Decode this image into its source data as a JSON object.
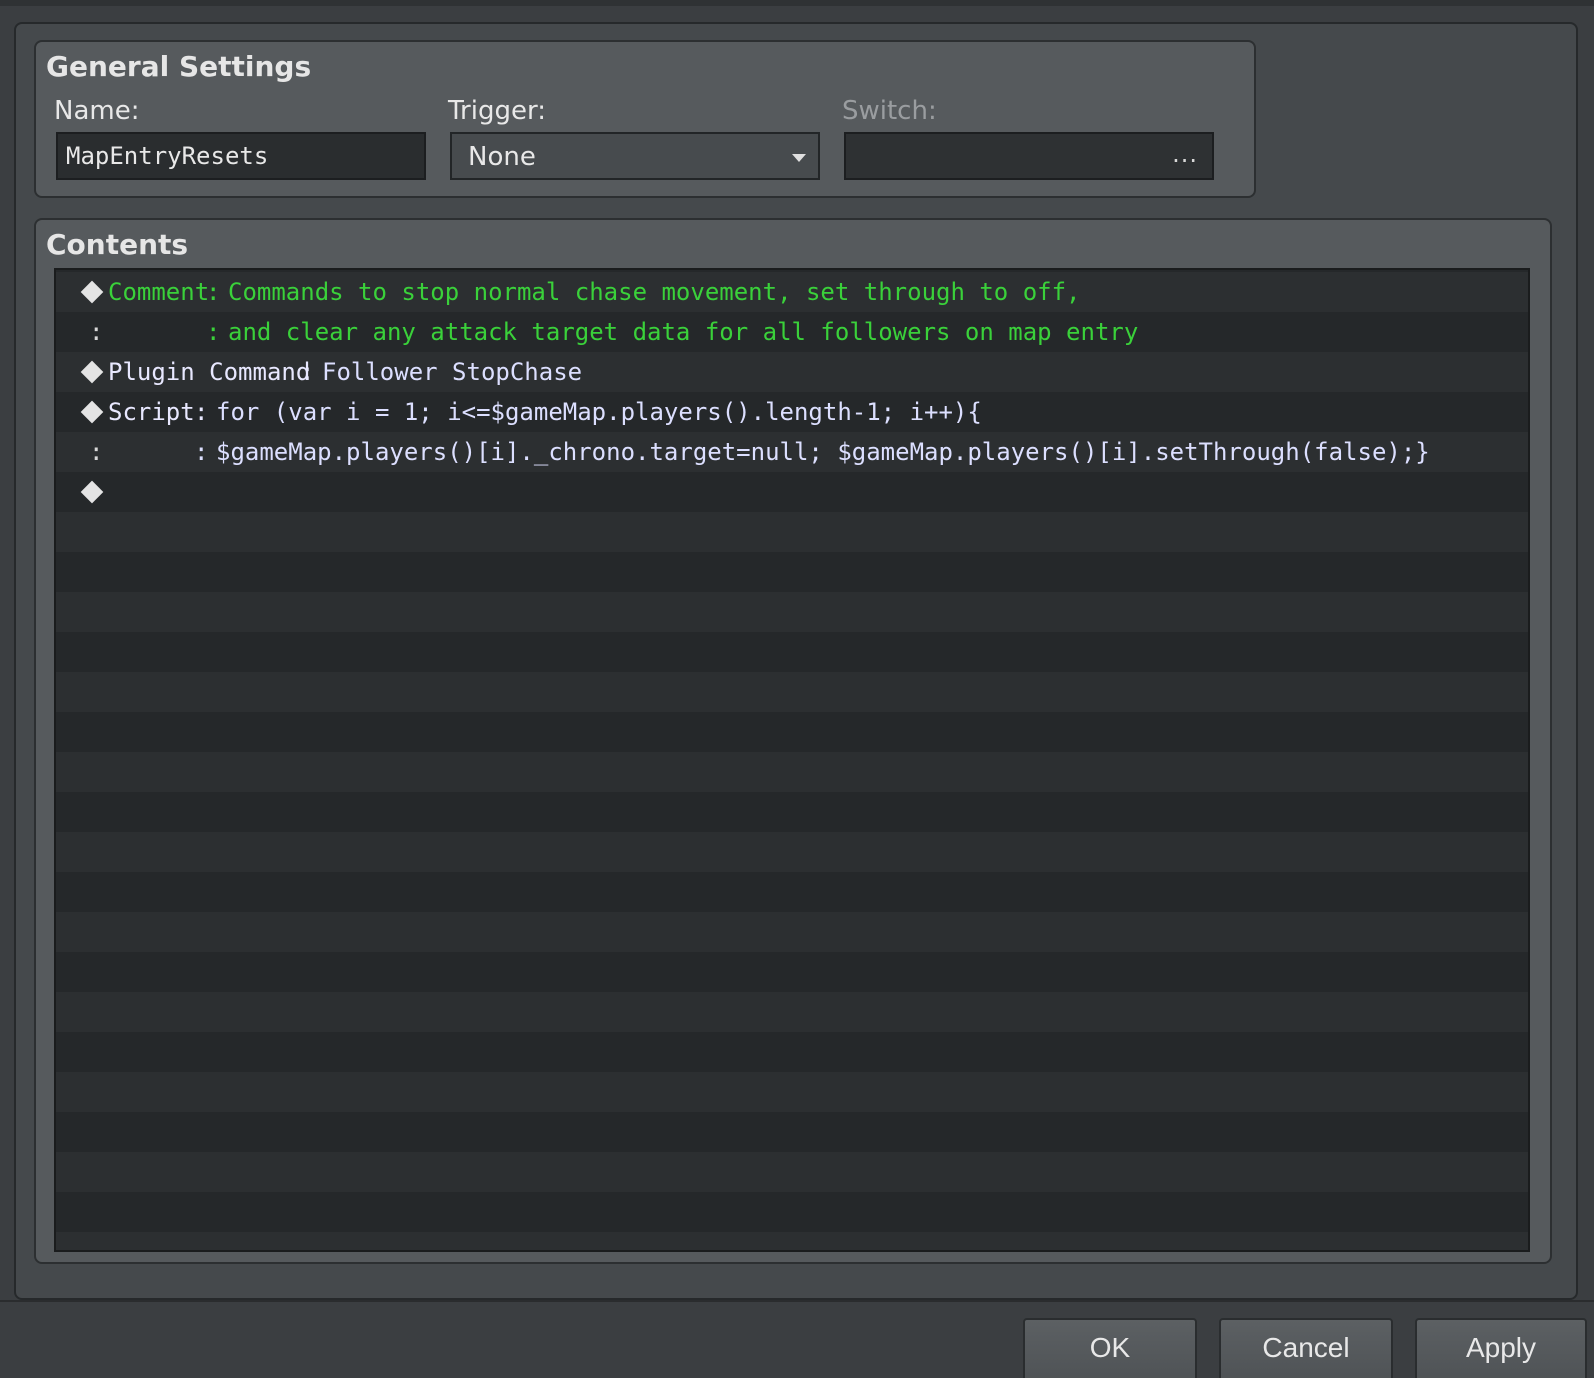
{
  "general": {
    "title": "General Settings",
    "name_label": "Name:",
    "name_value": "MapEntryResets",
    "trigger_label": "Trigger:",
    "trigger_value": "None",
    "switch_label": "Switch:",
    "switch_button": "..."
  },
  "contents": {
    "title": "Contents",
    "rows": [
      {
        "type": "comment",
        "label": "Comment",
        "sep": ":",
        "text": "Commands to stop normal chase movement, set through to off,"
      },
      {
        "type": "comment-cont",
        "lead": ":",
        "sep": ":",
        "text": "and clear any attack target data for all followers on map entry"
      },
      {
        "type": "plugin",
        "label": "Plugin Command",
        "sep": ":",
        "text": "Follower StopChase"
      },
      {
        "type": "script",
        "label": "Script",
        "sep": ":",
        "text": "for (var i = 1; i<=$gameMap.players().length-1; i++){"
      },
      {
        "type": "script-cont",
        "lead": ":",
        "sep": ":",
        "text": "$gameMap.players()[i]._chrono.target=null; $gameMap.players()[i].setThrough(false);}"
      },
      {
        "type": "empty"
      }
    ]
  },
  "buttons": {
    "ok": "OK",
    "cancel": "Cancel",
    "apply": "Apply"
  },
  "colors": {
    "comment": "#3ad13a",
    "command": "#e8e8ff",
    "background": "#25282a"
  }
}
